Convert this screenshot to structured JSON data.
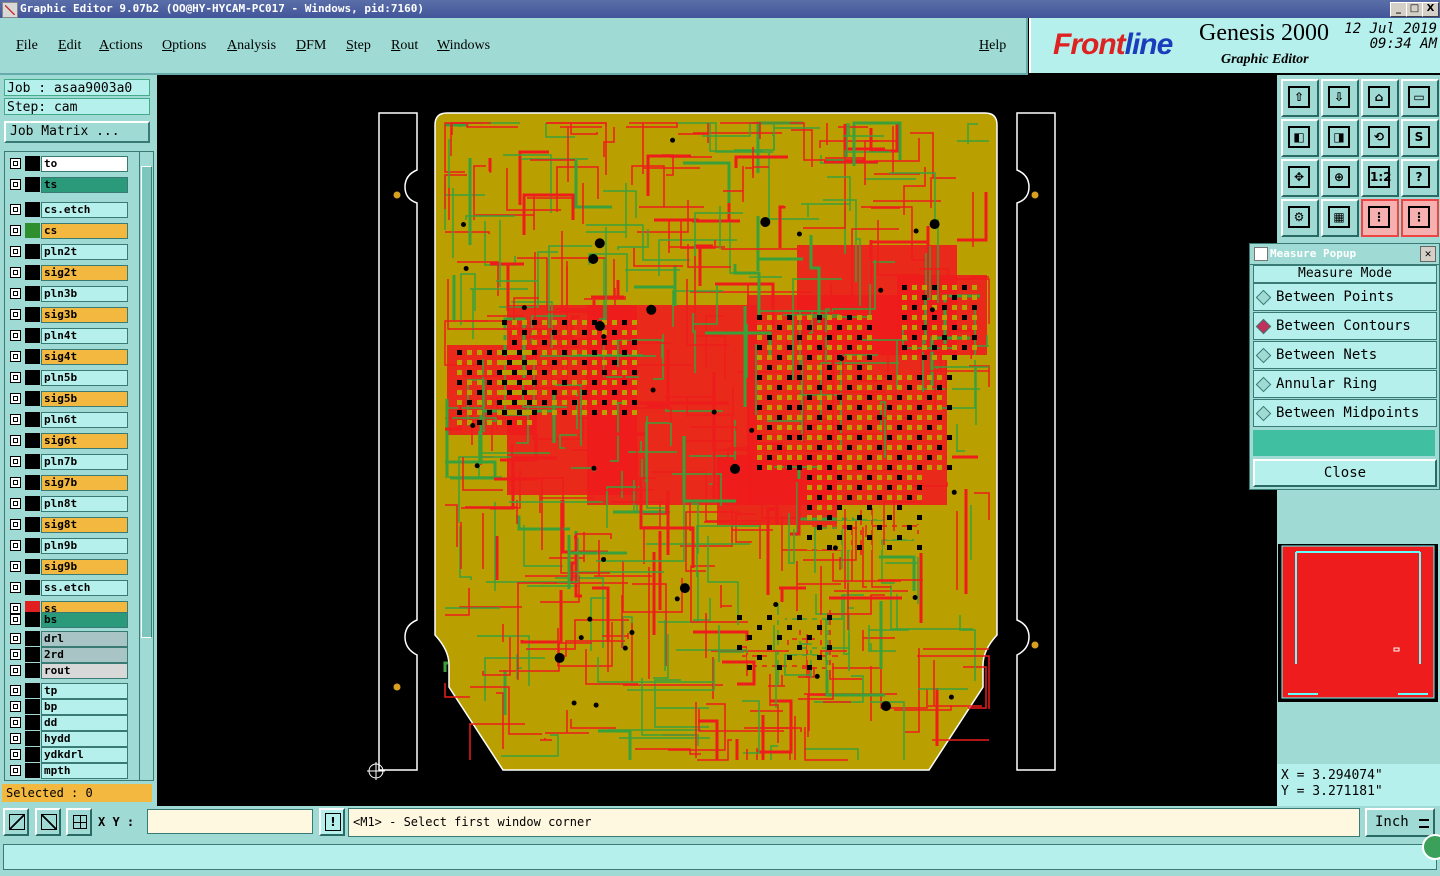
{
  "window": {
    "title": "Graphic Editor 9.07b2  (OO@HY-HYCAM-PC017 - Windows, pid:7160)",
    "min": "_",
    "max": "□",
    "close": "X"
  },
  "menu": [
    "File",
    "Edit",
    "Actions",
    "Options",
    "Analysis",
    "DFM",
    "Step",
    "Rout",
    "Windows"
  ],
  "help": "Help",
  "brand": {
    "logo_prefix": "Front",
    "logo_suffix": "line",
    "product": "Genesis 2000",
    "subtitle": "Graphic Editor",
    "date": "12 Jul 2019",
    "time": "09:34 AM"
  },
  "job": {
    "job_label": "Job : asaa9003a0",
    "step_label": "Step: cam",
    "matrix_button": "Job Matrix ..."
  },
  "layers": [
    {
      "name": "to",
      "color": "#ffffff",
      "swatch": "#000000"
    },
    {
      "name": "ts",
      "color": "#2a9a7a",
      "swatch": "#000000"
    },
    {
      "name": "cs.etch",
      "color": "#b6f0ec",
      "swatch": "#000000"
    },
    {
      "name": "cs",
      "color": "#f3b83f",
      "swatch": "#2f8f2f"
    },
    {
      "name": "pln2t",
      "color": "#b6f0ec",
      "swatch": "#000000"
    },
    {
      "name": "sig2t",
      "color": "#f3b83f",
      "swatch": "#000000"
    },
    {
      "name": "pln3b",
      "color": "#b6f0ec",
      "swatch": "#000000"
    },
    {
      "name": "sig3b",
      "color": "#f3b83f",
      "swatch": "#000000"
    },
    {
      "name": "pln4t",
      "color": "#b6f0ec",
      "swatch": "#000000"
    },
    {
      "name": "sig4t",
      "color": "#f3b83f",
      "swatch": "#000000"
    },
    {
      "name": "pln5b",
      "color": "#b6f0ec",
      "swatch": "#000000"
    },
    {
      "name": "sig5b",
      "color": "#f3b83f",
      "swatch": "#000000"
    },
    {
      "name": "pln6t",
      "color": "#b6f0ec",
      "swatch": "#000000"
    },
    {
      "name": "sig6t",
      "color": "#f3b83f",
      "swatch": "#000000"
    },
    {
      "name": "pln7b",
      "color": "#b6f0ec",
      "swatch": "#000000"
    },
    {
      "name": "sig7b",
      "color": "#f3b83f",
      "swatch": "#000000"
    },
    {
      "name": "pln8t",
      "color": "#b6f0ec",
      "swatch": "#000000"
    },
    {
      "name": "sig8t",
      "color": "#f3b83f",
      "swatch": "#000000"
    },
    {
      "name": "pln9b",
      "color": "#b6f0ec",
      "swatch": "#000000"
    },
    {
      "name": "sig9b",
      "color": "#f3b83f",
      "swatch": "#000000"
    },
    {
      "name": "ss.etch",
      "color": "#b6f0ec",
      "swatch": "#000000"
    },
    {
      "name": "ss",
      "color": "#f3b83f",
      "swatch": "#e02020"
    },
    {
      "name": "bs",
      "color": "#2a9a7a",
      "swatch": "#000000"
    },
    {
      "name": "drl",
      "color": "#a8c4c4",
      "swatch": "#000000"
    },
    {
      "name": "2rd",
      "color": "#a8c4c4",
      "swatch": "#000000"
    },
    {
      "name": "rout",
      "color": "#d8d8d8",
      "swatch": "#000000"
    },
    {
      "name": "tp",
      "color": "#b6f0ec",
      "swatch": "#000000"
    },
    {
      "name": "bp",
      "color": "#b6f0ec",
      "swatch": "#000000"
    },
    {
      "name": "dd",
      "color": "#b6f0ec",
      "swatch": "#000000"
    },
    {
      "name": "hydd",
      "color": "#b6f0ec",
      "swatch": "#000000"
    },
    {
      "name": "ydkdrl",
      "color": "#b6f0ec",
      "swatch": "#000000"
    },
    {
      "name": "mpth",
      "color": "#b6f0ec",
      "swatch": "#000000"
    }
  ],
  "selected": "Selected : 0",
  "toolbar_icons": [
    "layer-up-icon",
    "layer-down-icon",
    "home-icon",
    "window-icon",
    "pan-left-icon",
    "pan-right-icon",
    "zoom-back-icon",
    "redraw-icon",
    "fit-icon",
    "center-icon",
    "ratio-icon",
    "help-icon",
    "tools-icon",
    "grid-icon",
    "measure-left-icon",
    "measure-right-icon"
  ],
  "toolbar_glyphs": [
    "⇧",
    "⇩",
    "⌂",
    "▭",
    "◧",
    "◨",
    "⟲",
    "S",
    "✥",
    "⊕",
    "1:2",
    "?",
    "⚙",
    "▦",
    "⋮",
    "⋮"
  ],
  "measure": {
    "title": "Measure Popup",
    "heading": "Measure Mode",
    "options": [
      "Between Points",
      "Between Contours",
      "Between Nets",
      "Annular Ring",
      "Between Midpoints"
    ],
    "selected_index": 1,
    "close": "Close"
  },
  "coords": {
    "x": "X = 3.294074\"",
    "y": "Y = 3.271181\""
  },
  "bottom": {
    "xy_label": "X Y :",
    "xy_value": "",
    "status": "<M1> - Select first window corner",
    "unit": "Inch",
    "info_icon": "!"
  },
  "colors": {
    "board": "#b9a000",
    "copper": "#ee1c1c",
    "green_trace": "#3aa03a",
    "panel": "#9fdbd4"
  }
}
